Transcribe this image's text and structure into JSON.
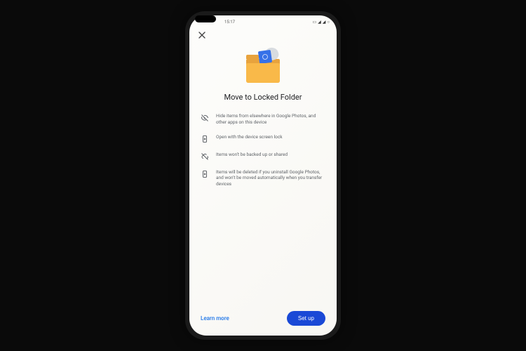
{
  "status": {
    "time": "15:17"
  },
  "title": "Move to Locked Folder",
  "features": [
    {
      "text": "Hide items from elsewhere in Google Photos, and other apps on this device"
    },
    {
      "text": "Open with the device screen lock"
    },
    {
      "text": "Items won't be backed up or shared"
    },
    {
      "text": "Items will be deleted if you uninstall Google Photos, and won't be moved automatically when you transfer devices"
    }
  ],
  "footer": {
    "learn_more": "Learn more",
    "setup": "Set up"
  }
}
